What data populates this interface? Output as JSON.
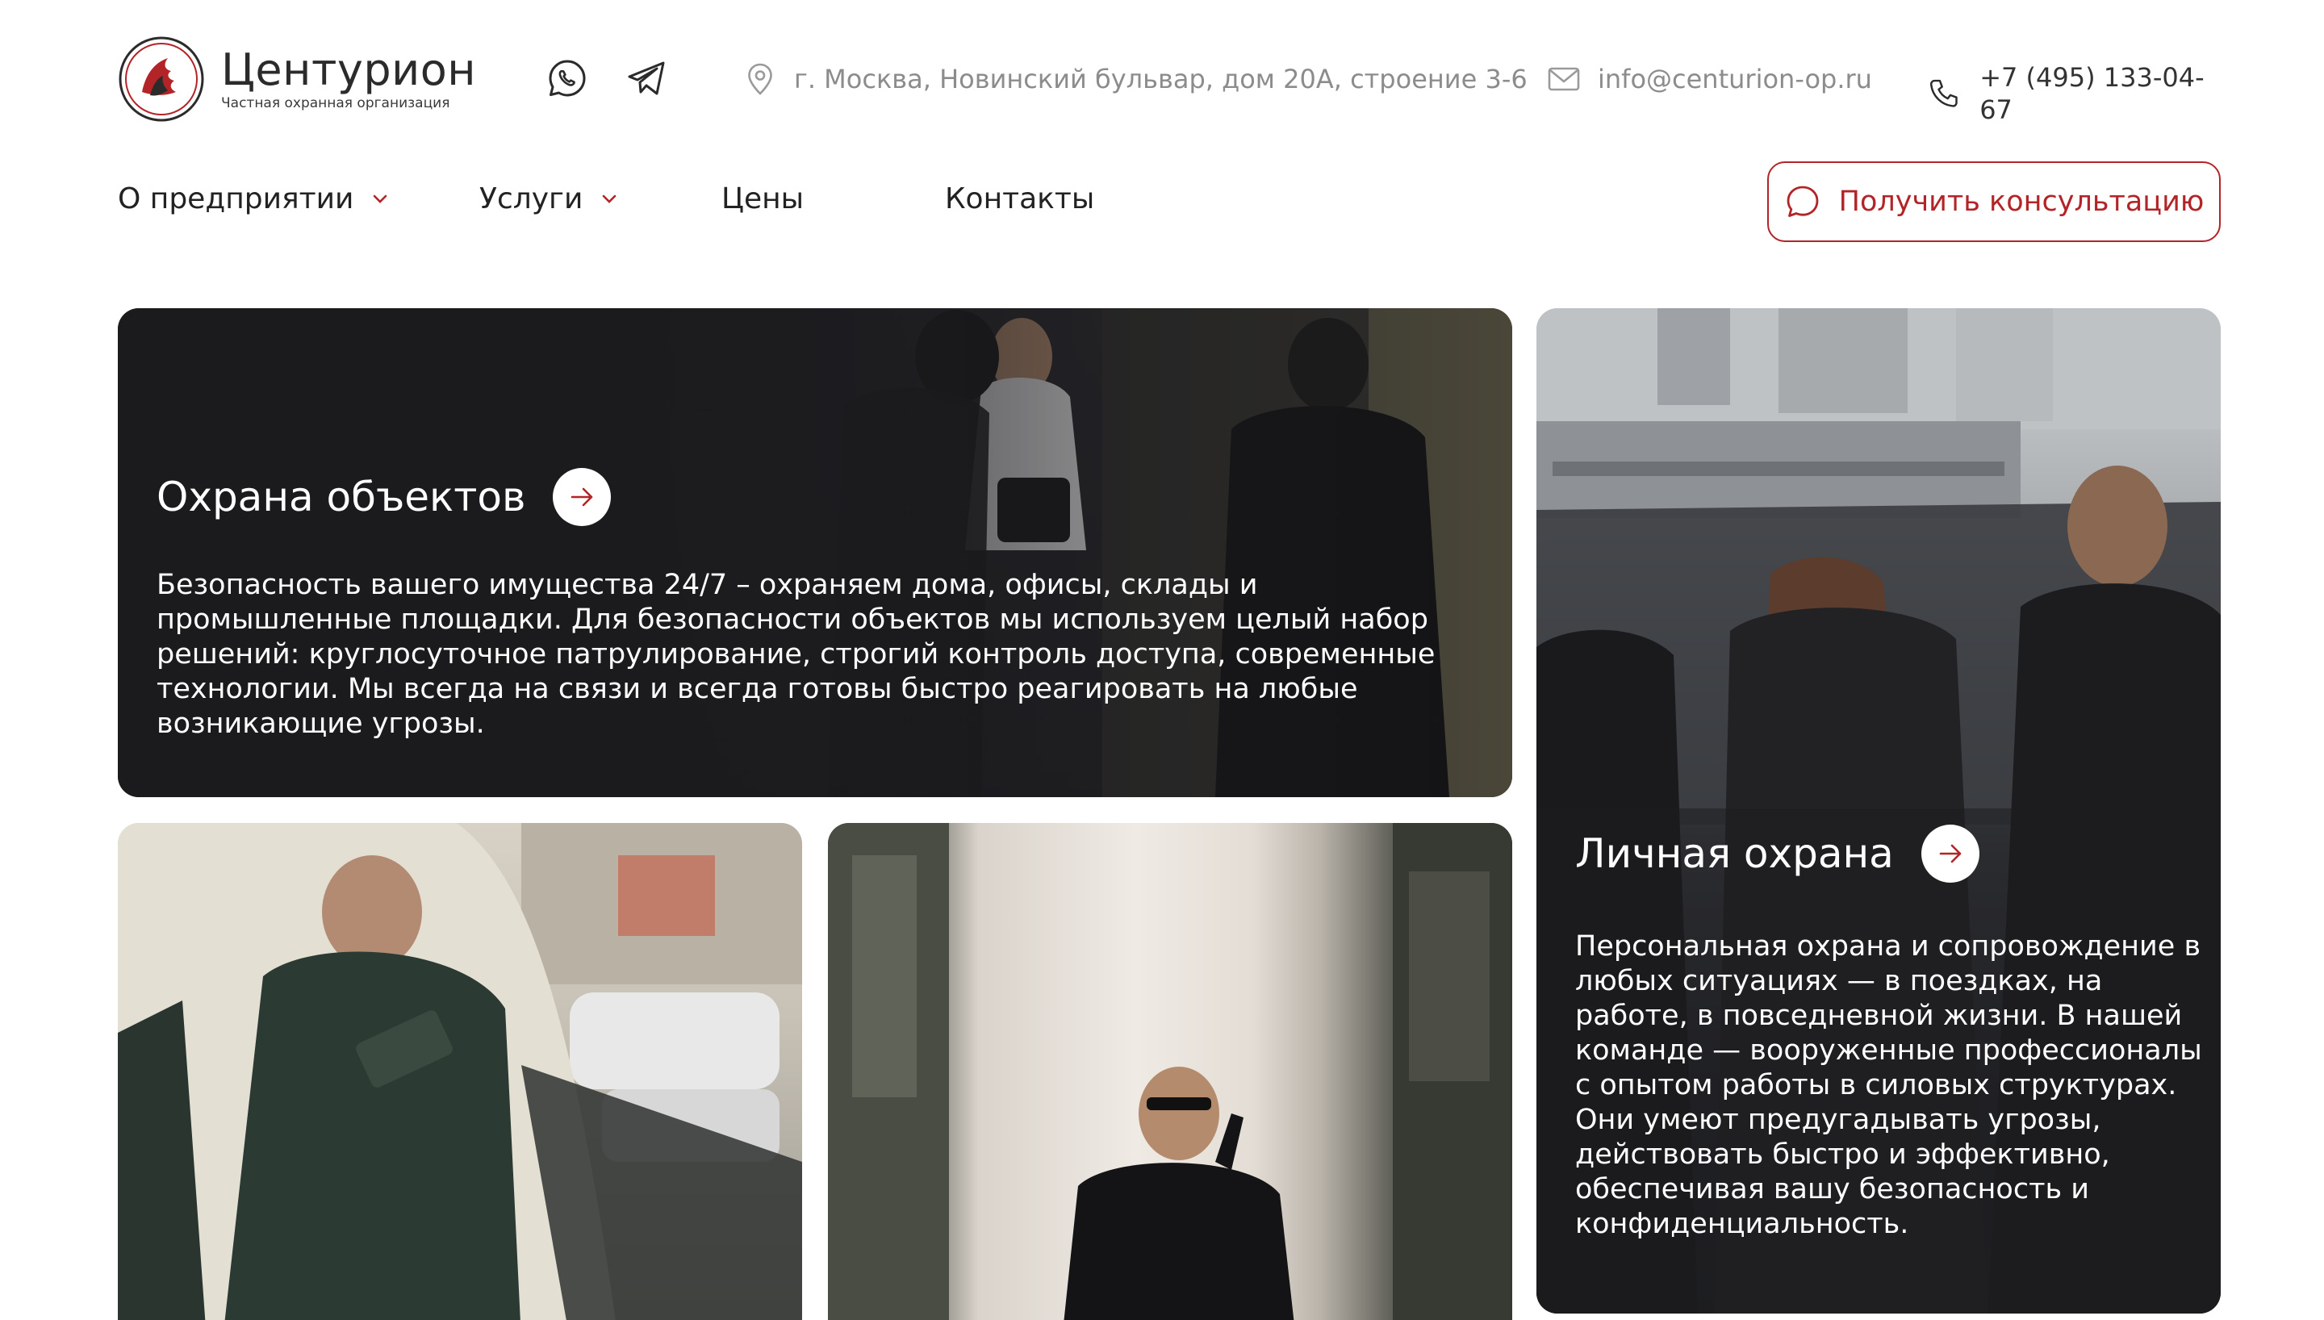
{
  "header": {
    "logo_title": "Центурион",
    "logo_subtitle": "Частная охранная организация",
    "address": "г. Москва, Новинский бульвар, дом 20А, строение 3-6",
    "email": "info@centurion-op.ru",
    "phone": "+7 (495) 133-04-67",
    "messengers": [
      "whatsapp-icon",
      "telegram-icon"
    ]
  },
  "nav": {
    "items": [
      {
        "label": "О предприятии",
        "dropdown": true
      },
      {
        "label": "Услуги",
        "dropdown": true
      },
      {
        "label": "Цены",
        "dropdown": false
      },
      {
        "label": "Контакты",
        "dropdown": false
      }
    ],
    "cta_label": "Получить консультацию"
  },
  "cards": {
    "objects": {
      "title": "Охрана объектов",
      "text": "Безопасность вашего имущества 24/7 – охраняем дома, офисы, склады и промышленные площадки. Для безопасности объектов мы используем целый набор решений: круглосуточное патрулирование, строгий контроль доступа, современные технологии. Мы всегда на связи и всегда готовы быстро реагировать на любые возникающие угрозы."
    },
    "personal": {
      "title": "Личная охрана",
      "text": "Персональная охрана и сопровождение в любых ситуациях — в поездках, на работе, в повседневной жизни. В нашей команде — вооруженные профессионалы с опытом работы в силовых структурах. Они умеют предугадывать угрозы, действовать быстро и эффективно, обеспечивая вашу безопасность и конфиденциальность."
    }
  },
  "colors": {
    "accent": "#b32428",
    "text_dark": "#222222",
    "text_muted": "#8c8c8c"
  }
}
